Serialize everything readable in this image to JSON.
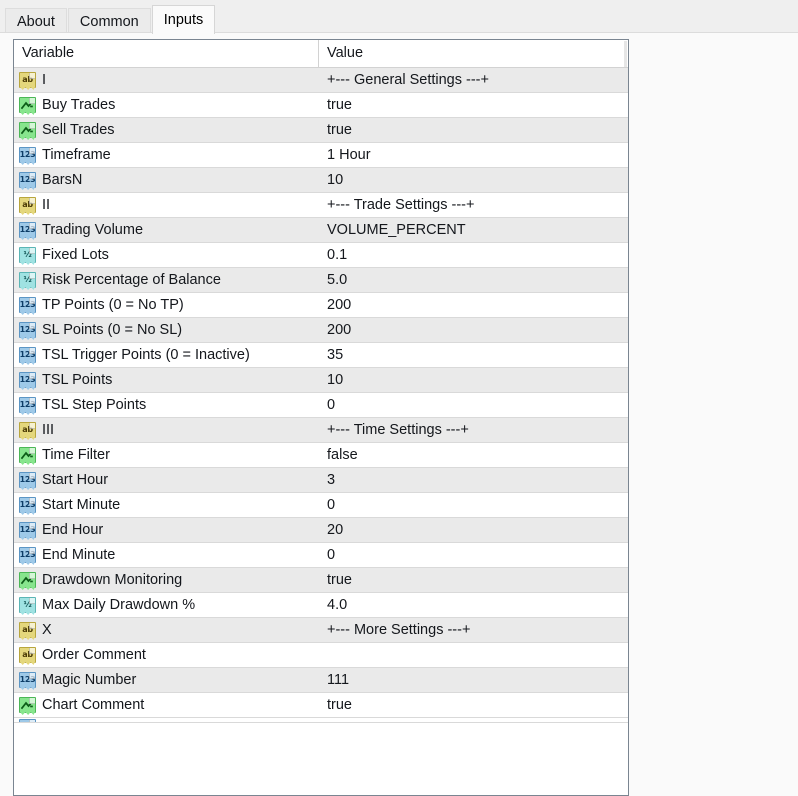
{
  "window": {
    "background_color": "#f6f6f6",
    "panel_color": "#fafafa"
  },
  "tabs": [
    {
      "label": "About",
      "active": false
    },
    {
      "label": "Common",
      "active": false
    },
    {
      "label": "Inputs",
      "active": true
    }
  ],
  "table": {
    "columns": [
      {
        "key": "variable",
        "label": "Variable"
      },
      {
        "key": "value",
        "label": "Value"
      }
    ],
    "row_colors": {
      "odd": "#ffffff",
      "even": "#eaeaea",
      "border": "#d9d9d9"
    },
    "icon_colors": {
      "string": "#e4d77c",
      "bool": "#87e58d",
      "int": "#9ec9e8",
      "double": "#9fe2e2"
    },
    "rows": [
      {
        "icon": "string-input-icon",
        "type": "string",
        "variable": "I",
        "value": "+--- General Settings ---+"
      },
      {
        "icon": "bool-input-icon",
        "type": "bool",
        "variable": "Buy Trades",
        "value": "true"
      },
      {
        "icon": "bool-input-icon",
        "type": "bool",
        "variable": "Sell Trades",
        "value": "true"
      },
      {
        "icon": "int-input-icon",
        "type": "int",
        "variable": "Timeframe",
        "value": "1 Hour"
      },
      {
        "icon": "int-input-icon",
        "type": "int",
        "variable": "BarsN",
        "value": "10"
      },
      {
        "icon": "string-input-icon",
        "type": "string",
        "variable": "II",
        "value": "+--- Trade Settings ---+"
      },
      {
        "icon": "int-input-icon",
        "type": "int",
        "variable": "Trading Volume",
        "value": "VOLUME_PERCENT"
      },
      {
        "icon": "double-input-icon",
        "type": "double",
        "variable": "Fixed Lots",
        "value": "0.1"
      },
      {
        "icon": "double-input-icon",
        "type": "double",
        "variable": "Risk Percentage of Balance",
        "value": "5.0"
      },
      {
        "icon": "int-input-icon",
        "type": "int",
        "variable": "TP Points (0 = No TP)",
        "value": "200"
      },
      {
        "icon": "int-input-icon",
        "type": "int",
        "variable": "SL Points (0 = No SL)",
        "value": "200"
      },
      {
        "icon": "int-input-icon",
        "type": "int",
        "variable": "TSL Trigger Points (0 = Inactive)",
        "value": "35"
      },
      {
        "icon": "int-input-icon",
        "type": "int",
        "variable": "TSL Points",
        "value": "10"
      },
      {
        "icon": "int-input-icon",
        "type": "int",
        "variable": "TSL Step Points",
        "value": "0"
      },
      {
        "icon": "string-input-icon",
        "type": "string",
        "variable": "III",
        "value": "+--- Time Settings ---+"
      },
      {
        "icon": "bool-input-icon",
        "type": "bool",
        "variable": "Time Filter",
        "value": "false"
      },
      {
        "icon": "int-input-icon",
        "type": "int",
        "variable": "Start Hour",
        "value": "3"
      },
      {
        "icon": "int-input-icon",
        "type": "int",
        "variable": "Start Minute",
        "value": "0"
      },
      {
        "icon": "int-input-icon",
        "type": "int",
        "variable": "End Hour",
        "value": "20"
      },
      {
        "icon": "int-input-icon",
        "type": "int",
        "variable": "End Minute",
        "value": "0"
      },
      {
        "icon": "bool-input-icon",
        "type": "bool",
        "variable": "Drawdown Monitoring",
        "value": "true"
      },
      {
        "icon": "double-input-icon",
        "type": "double",
        "variable": "Max Daily Drawdown %",
        "value": "4.0"
      },
      {
        "icon": "string-input-icon",
        "type": "string",
        "variable": "X",
        "value": "+--- More Settings ---+"
      },
      {
        "icon": "string-input-icon",
        "type": "string",
        "variable": "Order Comment",
        "value": ""
      },
      {
        "icon": "int-input-icon",
        "type": "int",
        "variable": "Magic Number",
        "value": "111"
      },
      {
        "icon": "bool-input-icon",
        "type": "bool",
        "variable": "Chart Comment",
        "value": "true"
      }
    ],
    "clipped_row": {
      "icon": "int-input-icon",
      "type": "int",
      "variable": "",
      "value": ""
    }
  },
  "icon_glyphs": {
    "string": "ab",
    "int": "123",
    "double": "½"
  }
}
